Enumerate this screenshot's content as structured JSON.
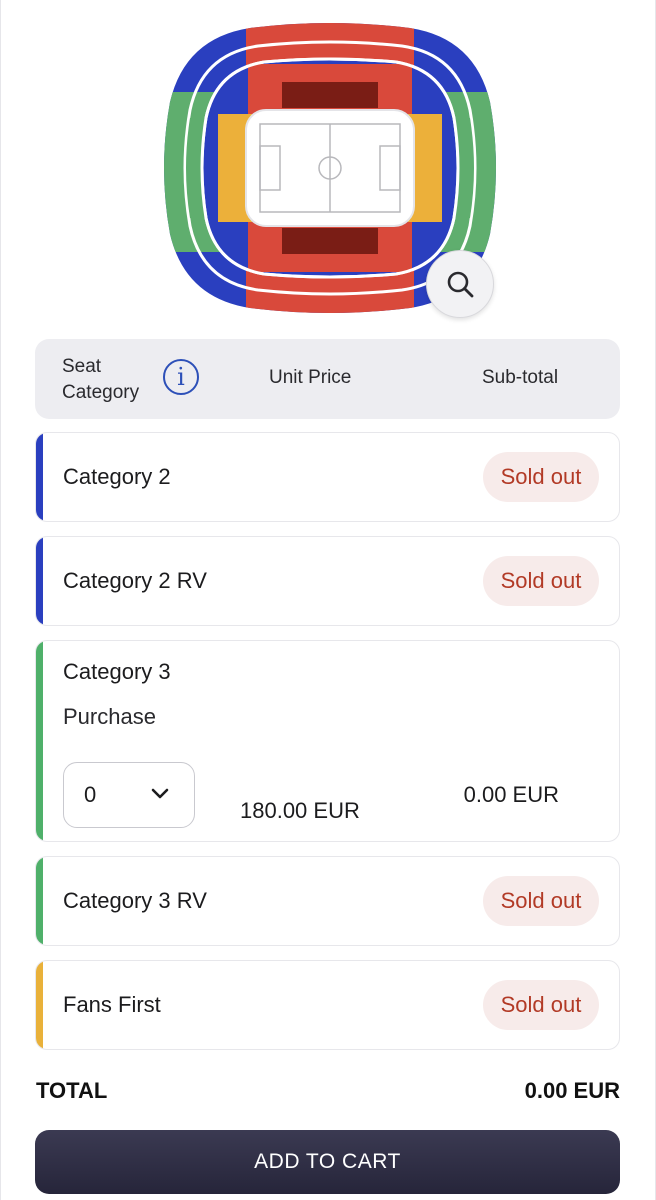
{
  "colors": {
    "category_2": "#2a3fbf",
    "category_3": "#4fb06a",
    "fans_first": "#e9b13a",
    "sold_out_text": "#b23a26",
    "button_bg": "#2e2d44"
  },
  "map": {
    "zoom_icon": "magnifier-icon"
  },
  "table_header": {
    "seat_category": "Seat Category",
    "unit_price": "Unit Price",
    "sub_total": "Sub-total",
    "info_icon": "i"
  },
  "rows": [
    {
      "name": "Category 2",
      "status": "Sold out"
    },
    {
      "name": "Category 2 RV",
      "status": "Sold out"
    },
    {
      "name": "Category 3",
      "purchase_label": "Purchase",
      "quantity": "0",
      "unit_price": "180.00 EUR",
      "subtotal": "0.00 EUR"
    },
    {
      "name": "Category 3 RV",
      "status": "Sold out"
    },
    {
      "name": "Fans First",
      "status": "Sold out"
    }
  ],
  "total": {
    "label": "TOTAL",
    "value": "0.00 EUR"
  },
  "add_to_cart_label": "ADD TO CART"
}
